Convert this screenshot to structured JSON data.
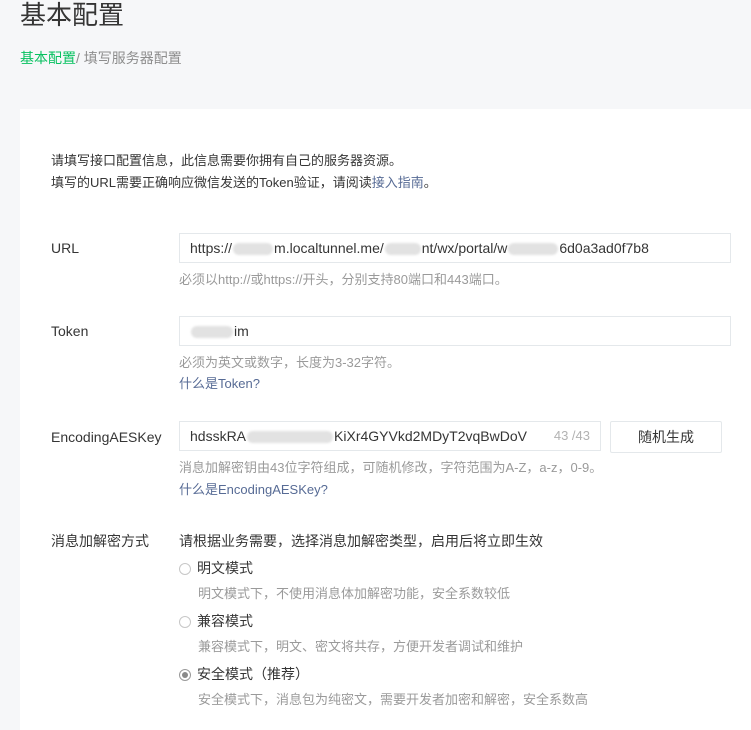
{
  "header": {
    "title": "基本配置",
    "breadcrumb_link": "基本配置",
    "breadcrumb_current": "/ 填写服务器配置"
  },
  "intro": {
    "line1": "请填写接口配置信息，此信息需要你拥有自己的服务器资源。",
    "line2_prefix": "填写的URL需要正确响应微信发送的Token验证，请阅读",
    "line2_link": "接入指南",
    "line2_suffix": "。"
  },
  "url": {
    "label": "URL",
    "value_part1": "https://",
    "value_part2": "m.localtunnel.me/",
    "value_part3": "nt/wx/portal/w",
    "value_part4": "6d0a3ad0f7b8",
    "hint": "必须以http://或https://开头，分别支持80端口和443端口。"
  },
  "token": {
    "label": "Token",
    "value_part1": "im",
    "hint": "必须为英文或数字，长度为3-32字符。",
    "help_link": "什么是Token?"
  },
  "aes": {
    "label": "EncodingAESKey",
    "value_part1": "hdsskRA",
    "value_part2": "KiXr4GYVkd2MDyT2vqBwDoV",
    "counter": "43 /43",
    "generate_button": "随机生成",
    "hint": "消息加解密钥由43位字符组成，可随机修改，字符范围为A-Z，a-z，0-9。",
    "help_link": "什么是EncodingAESKey?"
  },
  "encryption": {
    "label": "消息加解密方式",
    "instruction": "请根据业务需要，选择消息加解密类型，启用后将立即生效",
    "options": [
      {
        "label": "明文模式",
        "desc": "明文模式下，不使用消息体加解密功能，安全系数较低",
        "checked": false
      },
      {
        "label": "兼容模式",
        "desc": "兼容模式下，明文、密文将共存，方便开发者调试和维护",
        "checked": false
      },
      {
        "label": "安全模式（推荐）",
        "desc": "安全模式下，消息包为纯密文，需要开发者加密和解密，安全系数高",
        "checked": true
      }
    ]
  },
  "colors": {
    "accent_green": "#07c160",
    "link_blue": "#576b95"
  }
}
